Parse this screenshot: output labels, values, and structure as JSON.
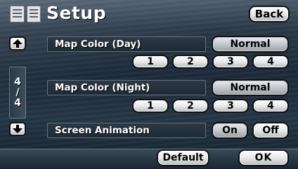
{
  "header": {
    "title": "Setup",
    "menu_icon": "list-panel-icon",
    "back_label": "Back"
  },
  "pager": {
    "current": "4",
    "separator": "/",
    "total": "4",
    "up_icon": "up-arrow-icon",
    "down_icon": "down-arrow-icon"
  },
  "settings": {
    "map_color_day": {
      "label": "Map Color (Day)",
      "mode": "Normal",
      "options": [
        "1",
        "2",
        "3",
        "4"
      ]
    },
    "map_color_night": {
      "label": "Map Color (Night)",
      "mode": "Normal",
      "options": [
        "1",
        "2",
        "3",
        "4"
      ]
    },
    "screen_animation": {
      "label": "Screen Animation",
      "on_label": "On",
      "off_label": "Off",
      "selected": "On"
    }
  },
  "footer": {
    "default_label": "Default",
    "ok_label": "OK"
  }
}
